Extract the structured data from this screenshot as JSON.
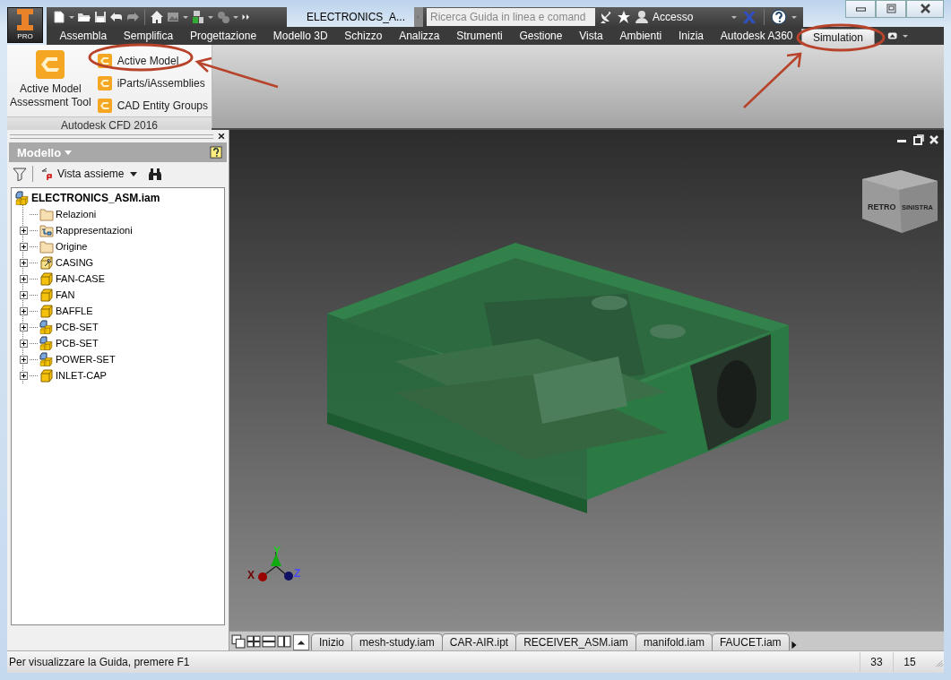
{
  "window": {
    "title": "ELECTRONICS_A..."
  },
  "app_button": {
    "label": "PRO"
  },
  "search": {
    "placeholder": "Ricerca Guida in linea e comand"
  },
  "account": {
    "label": "Accesso"
  },
  "ribbon_tabs": [
    {
      "label": "Assembla",
      "selected": false
    },
    {
      "label": "Semplifica",
      "selected": false
    },
    {
      "label": "Progettazione",
      "selected": false
    },
    {
      "label": "Modello 3D",
      "selected": false
    },
    {
      "label": "Schizzo",
      "selected": false
    },
    {
      "label": "Analizza",
      "selected": false
    },
    {
      "label": "Strumenti",
      "selected": false
    },
    {
      "label": "Gestione",
      "selected": false
    },
    {
      "label": "Vista",
      "selected": false
    },
    {
      "label": "Ambienti",
      "selected": false
    },
    {
      "label": "Inizia",
      "selected": false
    },
    {
      "label": "Autodesk A360",
      "selected": false
    },
    {
      "label": "Simulation",
      "selected": true
    }
  ],
  "ribbon_panel": {
    "title": "Autodesk CFD 2016",
    "large_button": {
      "label": "Active Model Assessment Tool"
    },
    "small_buttons": [
      {
        "label": "Active Model"
      },
      {
        "label": "iParts/iAssemblies"
      },
      {
        "label": "CAD Entity Groups"
      }
    ]
  },
  "browser": {
    "title": "Modello",
    "view": "Vista assieme",
    "tree": {
      "label": "ELECTRONICS_ASM.iam",
      "kind": "assembly",
      "children": [
        {
          "label": "Relazioni",
          "kind": "folder",
          "has_children": false
        },
        {
          "label": "Rappresentazioni",
          "kind": "representations",
          "has_children": true
        },
        {
          "label": "Origine",
          "kind": "folder",
          "has_children": true
        },
        {
          "label": "CASING",
          "kind": "pinned_part",
          "has_children": true
        },
        {
          "label": "FAN-CASE",
          "kind": "part",
          "has_children": true
        },
        {
          "label": "FAN",
          "kind": "part",
          "has_children": true
        },
        {
          "label": "BAFFLE",
          "kind": "part",
          "has_children": true
        },
        {
          "label": "PCB-SET",
          "kind": "assembly",
          "has_children": true
        },
        {
          "label": "PCB-SET",
          "kind": "assembly",
          "has_children": true
        },
        {
          "label": "POWER-SET",
          "kind": "assembly",
          "has_children": true
        },
        {
          "label": "INLET-CAP",
          "kind": "part",
          "has_children": true
        }
      ]
    }
  },
  "viewport": {
    "view_cube": {
      "left_face": "RETRO",
      "right_face": "SINISTRA"
    },
    "axes": [
      "X",
      "Y",
      "Z"
    ]
  },
  "document_tabs": [
    {
      "label": "Inizio"
    },
    {
      "label": "mesh-study.iam"
    },
    {
      "label": "CAR-AIR.ipt"
    },
    {
      "label": "RECEIVER_ASM.iam"
    },
    {
      "label": "manifold.iam"
    },
    {
      "label": "FAUCET.iam"
    }
  ],
  "status_bar": {
    "message": "Per visualizzare la Guida, premere F1",
    "cells": [
      "33",
      "15"
    ]
  }
}
